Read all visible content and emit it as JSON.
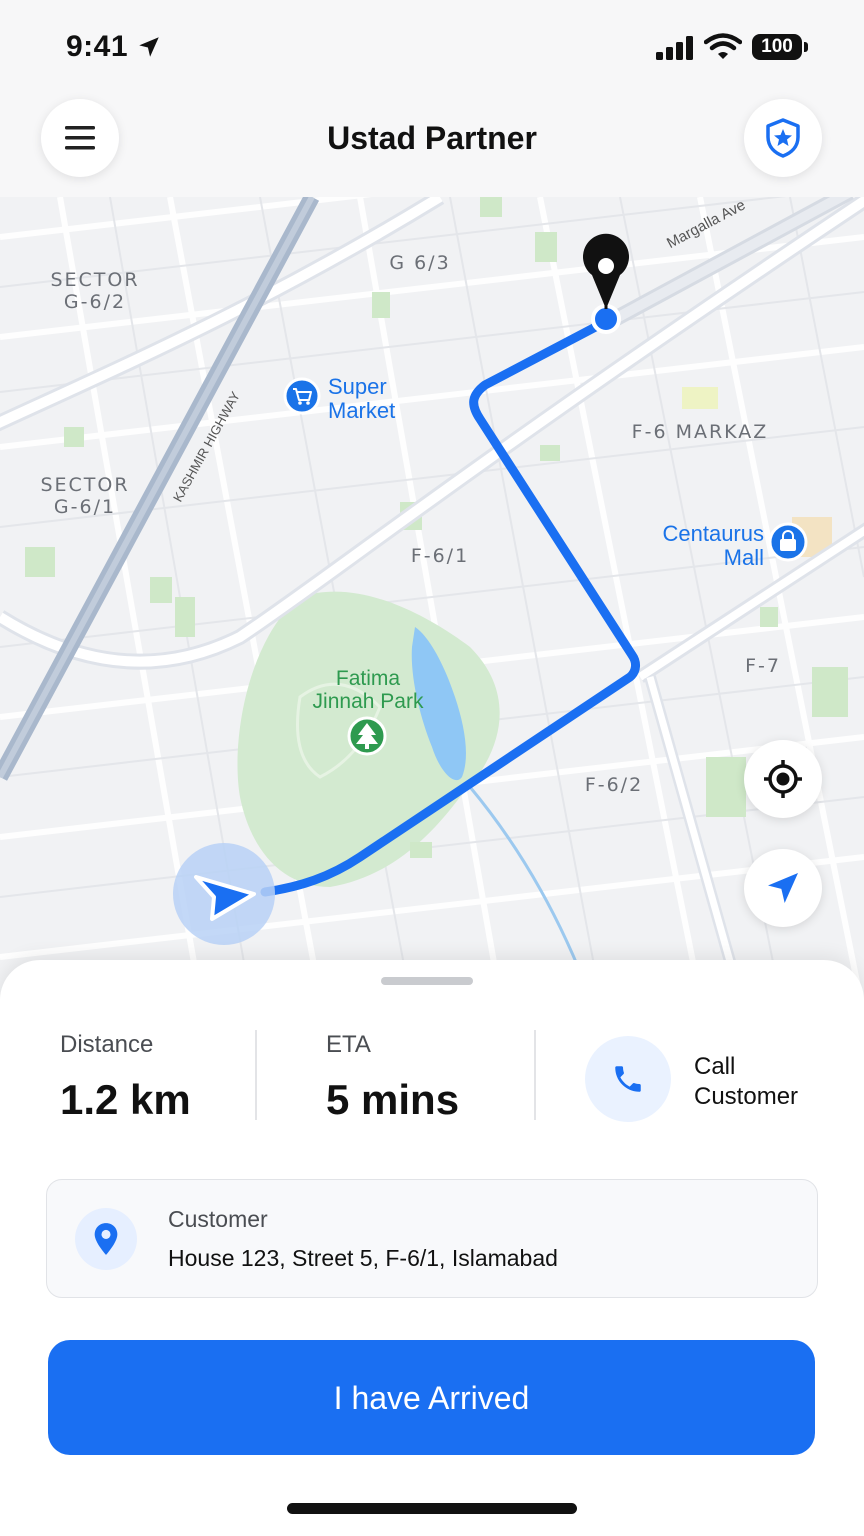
{
  "status_bar": {
    "time": "9:41",
    "battery": "100"
  },
  "header": {
    "title": "Ustad Partner",
    "menu_icon": "hamburger-menu-icon",
    "shield_icon": "shield-icon"
  },
  "map": {
    "labels": {
      "sector_g62": "SECTOR\nG-6/2",
      "g63": "G 6/3",
      "sector_g61": "SECTOR\nG-6/1",
      "f6_markaz": "F-6 MARKAZ",
      "f61": "F-6/1",
      "f7": "F-7",
      "f62": "F-6/2"
    },
    "roads": {
      "margalla": "Margalla Ave",
      "kashmir": "KASHMIR HIGHWAY"
    },
    "pois": {
      "super_market": "Super\nMarket",
      "centaurus": "Centaurus\nMall",
      "park": "Fatima\nJinnah Park"
    },
    "colors": {
      "route": "#1a6ff2",
      "park": "#cfe8c8",
      "water": "#8fc7f5"
    }
  },
  "trip": {
    "distance_label": "Distance",
    "distance_value": "1.2 km",
    "eta_label": "ETA",
    "eta_value": "5 mins",
    "call_label": "Call\nCustomer"
  },
  "customer": {
    "label": "Customer",
    "address": "House 123, Street 5, F-6/1, Islamabad"
  },
  "actions": {
    "arrived_label": "I have Arrived"
  }
}
